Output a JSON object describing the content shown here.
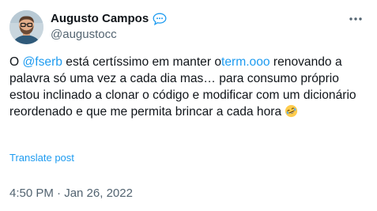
{
  "author": {
    "display_name": "Augusto Campos",
    "handle": "@augustocc",
    "badge_icon": "speech-bubble-icon"
  },
  "menu": {
    "icon": "more-horizontal-icon"
  },
  "tweet": {
    "t1": "O ",
    "mention": "@fserb",
    "t2": " está certíssimo em manter o",
    "url": "term.ooo",
    "t3": " renovando a palavra só uma vez a cada dia mas… para consumo próprio estou inclinado a clonar o código e modificar com um dicionário reordenado e que me permita brincar a cada hora ",
    "emoji": "rolling-on-floor-laughing-emoji"
  },
  "translate_label": "Translate post",
  "timestamp": "4:50 PM · Jan 26, 2022",
  "colors": {
    "link": "#1d9bf0",
    "text": "#0f1419",
    "secondary": "#536471"
  }
}
